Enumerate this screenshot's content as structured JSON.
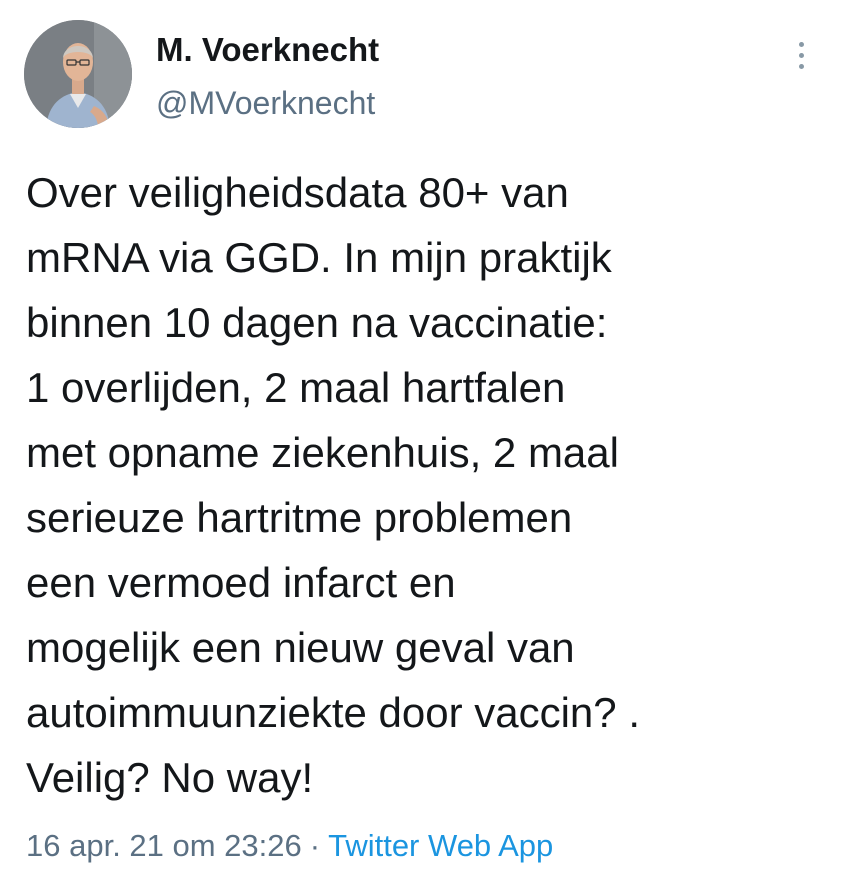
{
  "author": {
    "display_name": "M. Voerknecht",
    "handle": "@MVoerknecht"
  },
  "tweet": {
    "lines": [
      "Over veiligheidsdata 80+ van",
      "mRNA via GGD. In mijn praktijk",
      "binnen 10 dagen na vaccinatie:",
      "1 overlijden, 2 maal hartfalen",
      "met opname ziekenhuis, 2 maal",
      "serieuze hartritme problemen",
      "een vermoed infarct en",
      "mogelijk een nieuw geval van",
      "autoimmuunziekte door vaccin? .",
      "Veilig? No way!"
    ]
  },
  "meta": {
    "timestamp": "16 apr. 21 om 23:26",
    "separator": "·",
    "source": "Twitter Web App"
  },
  "icons": {
    "more": "more-vertical-icon"
  },
  "colors": {
    "text": "#14171a",
    "secondary": "#5b7083",
    "link": "#1b95e0"
  }
}
